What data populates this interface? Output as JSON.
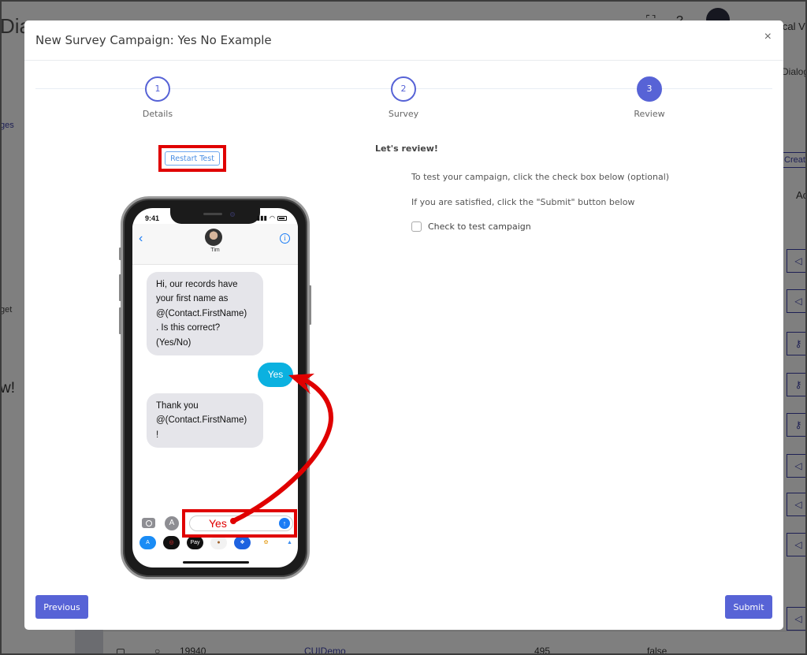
{
  "background": {
    "app_title_fragment": "Dia",
    "user_name_fragment": "ical V",
    "left_link_fragment": "ges",
    "left_text_fragment": "get",
    "left_heading_fragment": "w!",
    "right_header_fragment": "Dialog",
    "right_button_fragment": "Create",
    "right_column_fragment": "Ac",
    "bottom_row": {
      "id": "19940",
      "name": "CUIDemo",
      "count": "495",
      "flag": "false"
    }
  },
  "modal": {
    "title": "New Survey Campaign: Yes No Example",
    "close_icon": "×",
    "steps": [
      {
        "number": "1",
        "label": "Details",
        "state": "completed"
      },
      {
        "number": "2",
        "label": "Survey",
        "state": "completed"
      },
      {
        "number": "3",
        "label": "Review",
        "state": "active"
      }
    ],
    "review": {
      "heading": "Let's review!",
      "line1": "To test your campaign, click the check box below (optional)",
      "line2": "If you are satisfied, click the \"Submit\" button below",
      "checkbox_label": "Check to test campaign",
      "checkbox_checked": false
    },
    "buttons": {
      "previous": "Previous",
      "submit": "Submit"
    }
  },
  "phone": {
    "restart_button": "Restart Test",
    "status_time": "9:41",
    "contact_name": "Tim",
    "info_icon": "i",
    "back_icon": "‹",
    "messages": [
      {
        "direction": "incoming",
        "lines": [
          "Hi, our records have",
          "your first name as",
          "@(Contact.FirstName)",
          ". Is this correct?",
          "(Yes/No)"
        ]
      },
      {
        "direction": "outgoing",
        "text": "Yes"
      },
      {
        "direction": "incoming",
        "lines": [
          "Thank you",
          "@(Contact.FirstName)",
          "!"
        ]
      }
    ],
    "compose_text": "Yes",
    "send_icon": "↑",
    "app_strip": [
      {
        "name": "app-store-icon",
        "glyph": "A",
        "color": "#1a8cf5"
      },
      {
        "name": "activity-icon",
        "glyph": "◎",
        "color": "#111111"
      },
      {
        "name": "apple-pay-icon",
        "glyph": "Pay",
        "color": "#111111"
      },
      {
        "name": "monkey-emoji-icon",
        "glyph": "🐵",
        "color": "#f2f2f2"
      },
      {
        "name": "dropbox-icon",
        "glyph": "❖",
        "color": "#1e62e0"
      },
      {
        "name": "photos-icon",
        "glyph": "✿",
        "color": "#ffffff"
      },
      {
        "name": "more-app-icon",
        "glyph": "▲",
        "color": "#ffffff"
      }
    ]
  },
  "colors": {
    "accent": "#5763d6",
    "annotation_red": "#e00000",
    "outgoing_bubble": "#0bb1e0",
    "incoming_bubble": "#e5e5ea"
  }
}
